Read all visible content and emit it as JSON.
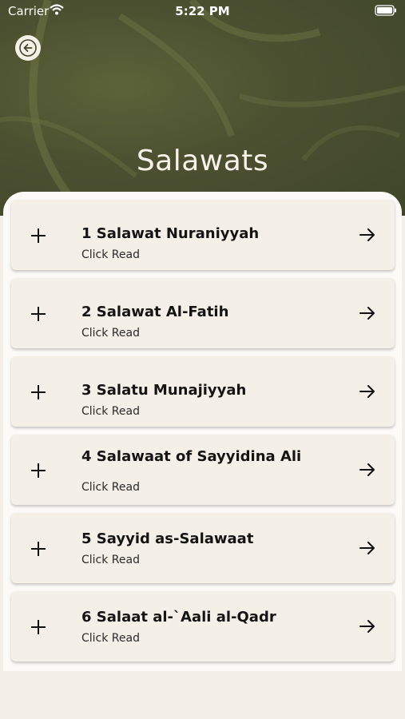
{
  "status_bar": {
    "carrier": "Carrier",
    "time": "5:22 PM"
  },
  "header": {
    "title": "Salawats"
  },
  "items": [
    {
      "title": "1 Salawat Nuraniyyah",
      "subtitle": "Click Read"
    },
    {
      "title": "2 Salawat Al-Fatih",
      "subtitle": "Click Read"
    },
    {
      "title": "3 Salatu Munajiyyah",
      "subtitle": "Click Read"
    },
    {
      "title": "4 Salawaat of Sayyidina Ali",
      "subtitle": "Click Read"
    },
    {
      "title": "5 Sayyid as-Salawaat",
      "subtitle": "Click Read"
    },
    {
      "title": "6 Salaat al-`Aali al-Qadr",
      "subtitle": "Click Read"
    }
  ],
  "colors": {
    "header": "#4a5030",
    "card": "#f4efe7",
    "panel": "#fbfaf7"
  }
}
